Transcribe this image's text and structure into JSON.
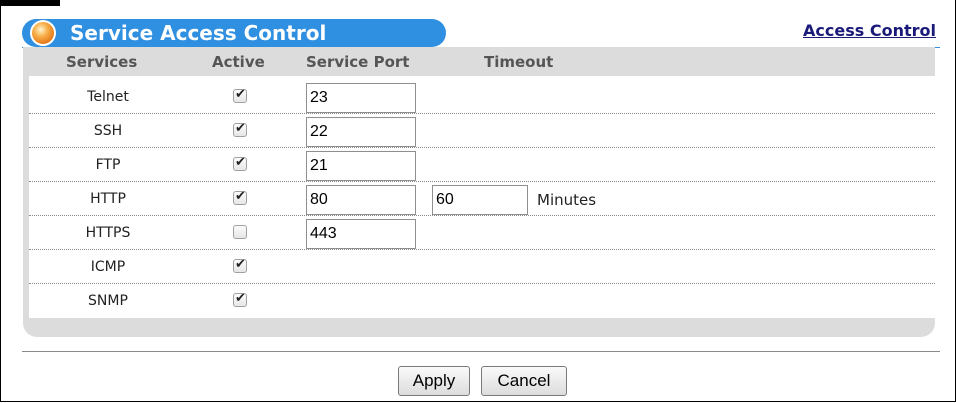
{
  "header": {
    "title": "Service Access Control",
    "link": "Access Control"
  },
  "table": {
    "columns": {
      "services": "Services",
      "active": "Active",
      "service_port": "Service Port",
      "timeout": "Timeout"
    },
    "rows": [
      {
        "service": "Telnet",
        "active": true,
        "port": "23"
      },
      {
        "service": "SSH",
        "active": true,
        "port": "22"
      },
      {
        "service": "FTP",
        "active": true,
        "port": "21"
      },
      {
        "service": "HTTP",
        "active": true,
        "port": "80",
        "timeout": "60",
        "timeout_unit": "Minutes"
      },
      {
        "service": "HTTPS",
        "active": false,
        "port": "443"
      },
      {
        "service": "ICMP",
        "active": true
      },
      {
        "service": "SNMP",
        "active": true
      }
    ]
  },
  "buttons": {
    "apply": "Apply",
    "cancel": "Cancel"
  }
}
